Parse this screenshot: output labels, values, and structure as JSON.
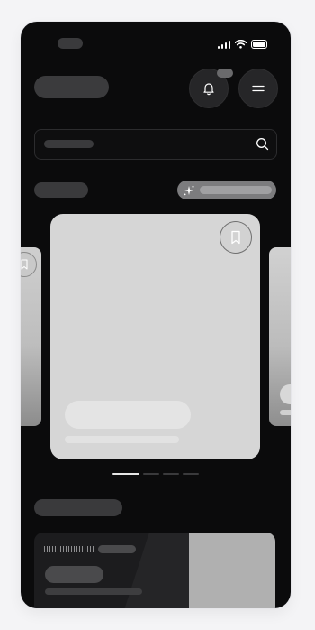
{
  "status_bar": {
    "icons": [
      "cellular-signal-icon",
      "wifi-icon",
      "battery-icon"
    ]
  },
  "header": {
    "actions": [
      "bell-icon",
      "menu-icon"
    ]
  },
  "search": {
    "icon": "search-icon"
  },
  "filters": {
    "ai_chip_icon": "sparkle-icon"
  },
  "carousel": {
    "slides": 4,
    "active_index": 0,
    "bookmark_icon": "bookmark-icon"
  },
  "colors": {
    "screen_bg": "#0b0b0c",
    "placeholder_dark": "#3a3a3c",
    "card_bg": "#d6d6d6",
    "active_indicator": "#e6e6e6"
  }
}
